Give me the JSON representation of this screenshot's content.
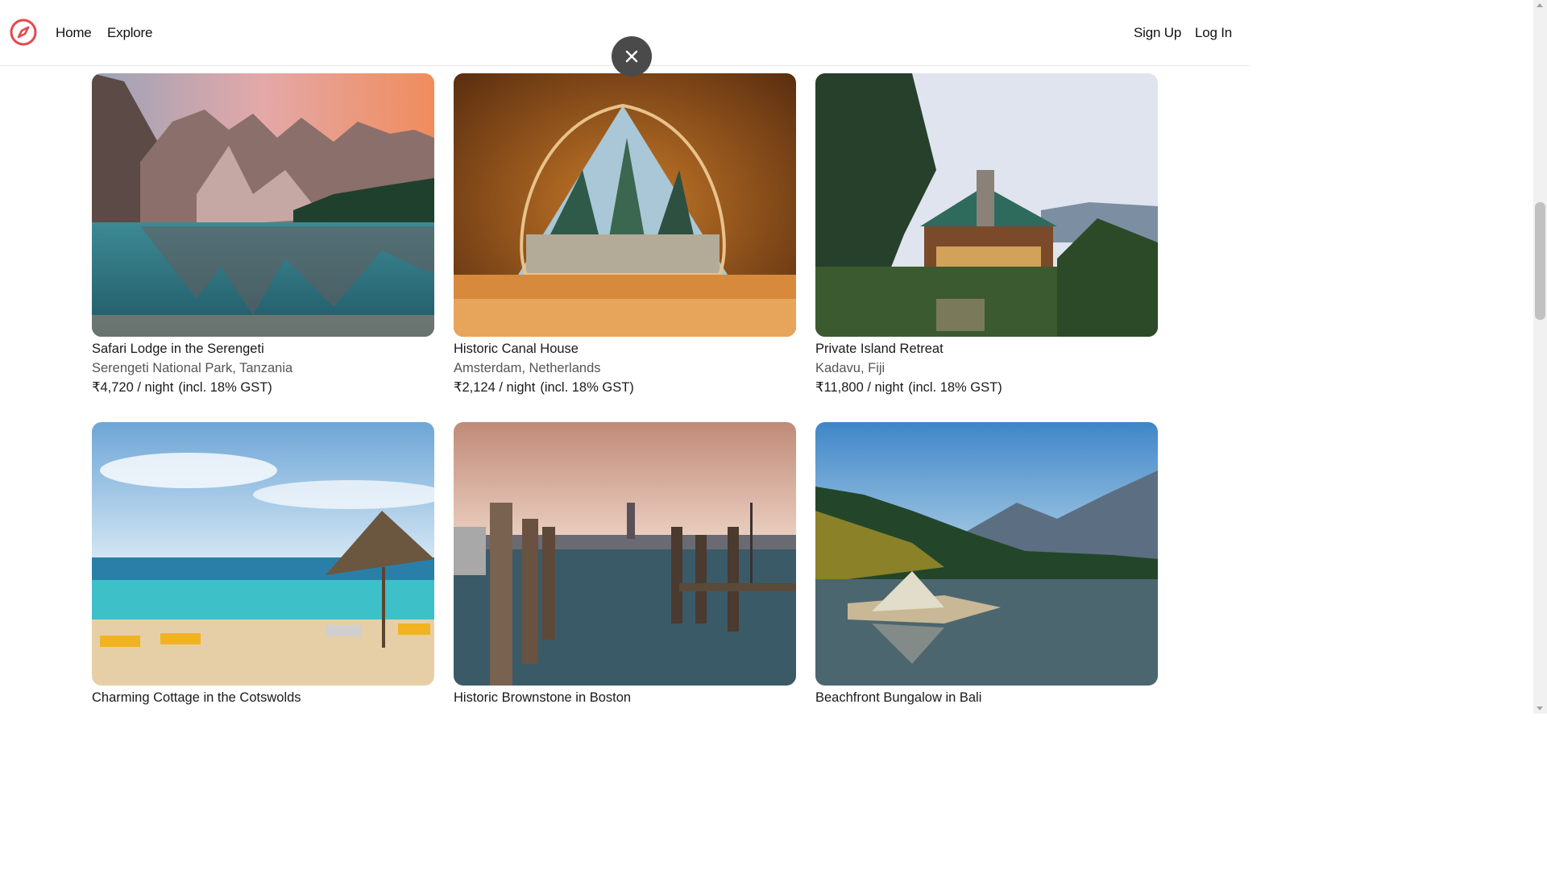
{
  "nav": {
    "home": "Home",
    "explore": "Explore",
    "signup": "Sign Up",
    "login": "Log In",
    "brand_color": "#e5484d"
  },
  "overlay": {
    "close_icon": "close-icon"
  },
  "listings": [
    {
      "title": "Safari Lodge in the Serengeti",
      "location": "Serengeti National Park, Tanzania",
      "price": "₹4,720 / night",
      "tax_note": "(incl. 18% GST)",
      "image": "mountain-lake-photo"
    },
    {
      "title": "Historic Canal House",
      "location": "Amsterdam, Netherlands",
      "price": "₹2,124 / night",
      "tax_note": "(incl. 18% GST)",
      "image": "tent-forest-view-photo"
    },
    {
      "title": "Private Island Retreat",
      "location": "Kadavu, Fiji",
      "price": "₹11,800 / night",
      "tax_note": "(incl. 18% GST)",
      "image": "wooden-lodge-photo"
    },
    {
      "title": "Charming Cottage in the Cotswolds",
      "location": "",
      "price": "",
      "tax_note": "",
      "image": "beach-umbrella-photo"
    },
    {
      "title": "Historic Brownstone in Boston",
      "location": "",
      "price": "",
      "tax_note": "",
      "image": "venice-pier-photo"
    },
    {
      "title": "Beachfront Bungalow in Bali",
      "location": "",
      "price": "",
      "tax_note": "",
      "image": "lakeside-tent-photo"
    }
  ]
}
